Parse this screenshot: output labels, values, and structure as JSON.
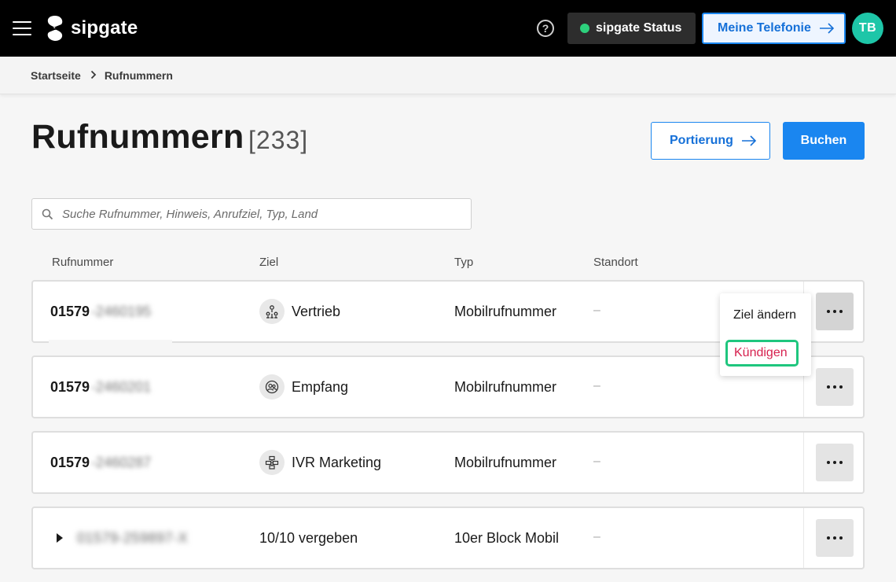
{
  "header": {
    "brand": "sipgate",
    "help_symbol": "?",
    "status_label": "sipgate Status",
    "status_color": "#2dd07c",
    "telefonie_label": "Meine Telefonie",
    "avatar_initials": "TB"
  },
  "breadcrumb": {
    "items": [
      {
        "label": "Startseite"
      },
      {
        "label": "Rufnummern"
      }
    ]
  },
  "page": {
    "title": "Rufnummern",
    "count": "[233]",
    "portierung_label": "Portierung",
    "buchen_label": "Buchen"
  },
  "search": {
    "placeholder": "Suche Rufnummer, Hinweis, Anrufziel, Typ, Land",
    "value": ""
  },
  "table": {
    "columns": [
      "Rufnummer",
      "Ziel",
      "Typ",
      "Standort"
    ],
    "rows": [
      {
        "number_prefix": "01579",
        "number_rest": "-2460195",
        "target": "Vertrieb",
        "target_icon": "group-structure-icon",
        "typ": "Mobilrufnummer",
        "standort": "–"
      },
      {
        "number_prefix": "01579",
        "number_rest": "-2460201",
        "target": "Empfang",
        "target_icon": "people-icon",
        "typ": "Mobilrufnummer",
        "standort": "–"
      },
      {
        "number_prefix": "01579",
        "number_rest": "-2460287",
        "target": "IVR Marketing",
        "target_icon": "ivr-icon",
        "typ": "Mobilrufnummer",
        "standort": "–"
      },
      {
        "number_full": "01579-259897-X",
        "target": "10/10 vergeben",
        "typ": "10er Block Mobil",
        "standort": "–"
      }
    ]
  },
  "dropdown": {
    "items": [
      "Ziel ändern",
      "Kündigen"
    ]
  },
  "colors": {
    "accent": "#1a86f0",
    "danger_text": "#d6204e",
    "focus_ring": "#1fc67e",
    "avatar_bg": "#1ec6a8"
  }
}
